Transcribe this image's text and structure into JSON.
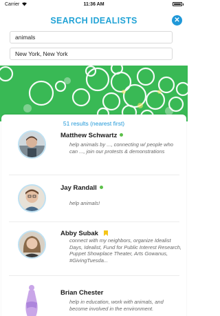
{
  "status_bar": {
    "carrier": "Carrier",
    "time": "11:36 AM"
  },
  "header": {
    "title": "SEARCH IDEALISTS",
    "close_icon": "close-icon"
  },
  "search": {
    "keyword_value": "animals",
    "location_value": "New York, New York"
  },
  "results": {
    "count_label": "51 results (nearest first)",
    "items": [
      {
        "name": "Matthew Schwartz",
        "status": "online",
        "bio": "help animals by ..., connecting w/ people who can ..., join our protests & demonstrations"
      },
      {
        "name": "Jay Randall",
        "status": "online",
        "bio": "help animals!"
      },
      {
        "name": "Abby Subak",
        "status": "bookmarked",
        "bio": "connect with my neighbors, organize Idealist Days, Idealist, Fund for Public Interest Research, Puppet Showplace Theater, Arts Gowanus, #GivingTuesda..."
      },
      {
        "name": "Brian Chester",
        "status": "",
        "bio": "help in education, work with animals, and become involved in the environment."
      }
    ]
  },
  "colors": {
    "accent": "#22a3d6",
    "online": "#5cc04a",
    "bookmark": "#f5c518",
    "hero_green": "#3fbf5a"
  }
}
